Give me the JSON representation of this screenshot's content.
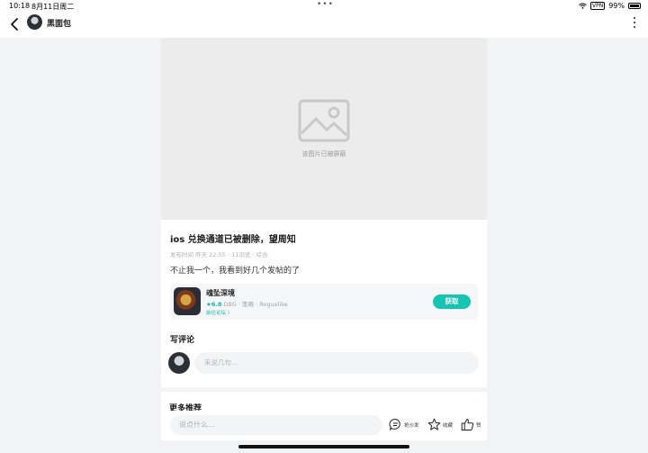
{
  "status_bar": {
    "time": "10:18",
    "date": "8月11日周二",
    "dots": "•••",
    "vpn": "VPN",
    "battery": "99%"
  },
  "nav": {
    "title": "黑面包",
    "back_icon": "chevron-left-icon",
    "more_icon": "vertical-dots-icon"
  },
  "post": {
    "image_caption": "该图片已被屏蔽",
    "title": "ios 兑换通道已被删除，望周知",
    "meta": "发布时间 昨天 22:55 · 11浏览 · 综合",
    "body": "不止我一个，我看到好几个发帖的了"
  },
  "game_card": {
    "name": "魂坠深境",
    "rating": "★6.8",
    "tags": " DBG · 策略 · Roguelike",
    "forum_link": "前往论坛 〉",
    "get_button": "获取"
  },
  "comments": {
    "heading": "写评论",
    "placeholder": "来说几句..."
  },
  "more": {
    "heading": "更多推荐"
  },
  "bottom_bar": {
    "input_placeholder": "说点什么...",
    "reply_label": "抢沙发",
    "favorite_label": "收藏",
    "like_label": "赞"
  },
  "colors": {
    "accent": "#15c5b2",
    "background": "#f2f3f5"
  }
}
